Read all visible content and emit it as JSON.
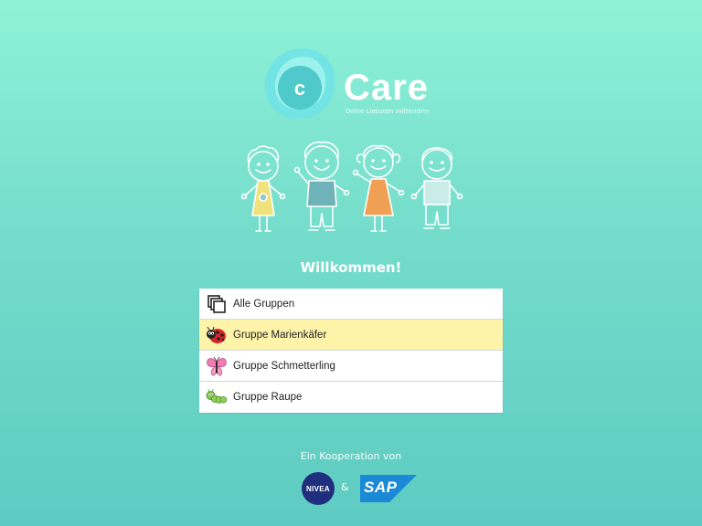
{
  "app": {
    "name": "Care",
    "logo_letter": "c",
    "tagline": "Deine Liebsten mittendrin"
  },
  "welcome": "Willkommen!",
  "groups": [
    {
      "label": "Alle Gruppen",
      "icon": "stack-icon",
      "selected": false
    },
    {
      "label": "Gruppe Marienkäfer",
      "icon": "ladybug-icon",
      "selected": true
    },
    {
      "label": "Gruppe Schmetterling",
      "icon": "butterfly-icon",
      "selected": false
    },
    {
      "label": "Gruppe Raupe",
      "icon": "caterpillar-icon",
      "selected": false
    }
  ],
  "footer": {
    "cooperation": "Ein Kooperation von",
    "partner1": "NIVEA",
    "separator": "&",
    "partner2": "SAP"
  },
  "colors": {
    "background_top": "#8ff2d8",
    "background_bottom": "#5ecbc2",
    "selected_row": "#fdf3a9",
    "nivea_blue": "#1f2f7d",
    "sap_blue": "#1b8ad6"
  }
}
